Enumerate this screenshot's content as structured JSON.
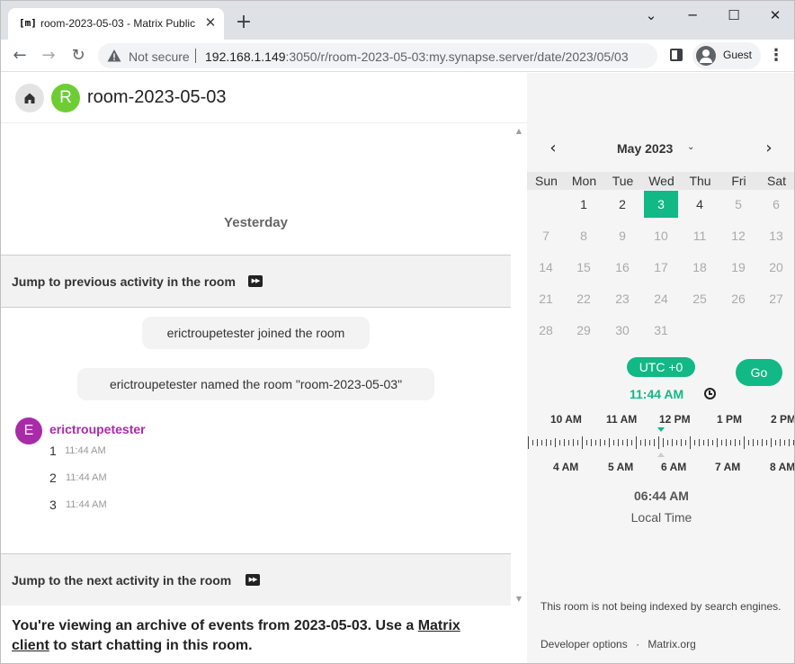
{
  "browser": {
    "tab_title": "room-2023-05-03 - Matrix Public",
    "tab_favicon_text": "[m]",
    "tab_close": "✕",
    "new_tab": "+",
    "window_controls": {
      "minimize": "⌄",
      "minimize2": "─",
      "maximize": "☐",
      "close": "✕"
    },
    "nav": {
      "back": "←",
      "forward": "→",
      "reload": "↻"
    },
    "security_label": "Not secure",
    "url_host": "192.168.1.149",
    "url_rest": ":3050/r/room-2023-05-03:my.synapse.server/date/2023/05/03",
    "profile_label": "Guest",
    "menu_glyph": "⋮"
  },
  "room": {
    "name": "room-2023-05-03",
    "avatar_letter": "R",
    "avatar_color": "#6dce33"
  },
  "timeline": {
    "day_divider": "Yesterday",
    "jump_previous": "Jump to previous activity in the room",
    "jump_next": "Jump to the next activity in the room",
    "jump_icon": "▶▶",
    "state_events": [
      "erictroupetester joined the room",
      "erictroupetester named the room \"room-2023-05-03\""
    ],
    "sender": {
      "name": "erictroupetester",
      "avatar_letter": "E",
      "color": "#a82ba8"
    },
    "messages": [
      {
        "body": "1",
        "time": "11:44 AM"
      },
      {
        "body": "2",
        "time": "11:44 AM"
      },
      {
        "body": "3",
        "time": "11:44 AM"
      }
    ],
    "scroll_up": "▲",
    "scroll_down": "▼"
  },
  "archive_notice": {
    "before_link": "You're viewing an archive of events from 2023-05-03. Use a ",
    "link_text_1": "Matrix",
    "link_text_2": "client",
    "after_link": " to start chatting in this room."
  },
  "calendar": {
    "prev": "‹",
    "next": "›",
    "month_label": "May 2023",
    "caret": "⌄",
    "weekdays": [
      "Sun",
      "Mon",
      "Tue",
      "Wed",
      "Thu",
      "Fri",
      "Sat"
    ],
    "weeks": [
      [
        "",
        "1",
        "2",
        "3",
        "4",
        "5",
        "6"
      ],
      [
        "7",
        "8",
        "9",
        "10",
        "11",
        "12",
        "13"
      ],
      [
        "14",
        "15",
        "16",
        "17",
        "18",
        "19",
        "20"
      ],
      [
        "21",
        "22",
        "23",
        "24",
        "25",
        "26",
        "27"
      ],
      [
        "28",
        "29",
        "30",
        "31",
        "",
        "",
        ""
      ]
    ],
    "active_days": [
      "1",
      "2",
      "3",
      "4"
    ],
    "selected_day": "3",
    "accent_color": "#12b886"
  },
  "time_picker": {
    "timezone_button": "UTC +0",
    "go_button": "Go",
    "selected_time": "11:44 AM",
    "top_labels": [
      "10 AM",
      "11 AM",
      "12 PM",
      "1 PM",
      "2 PM"
    ],
    "bottom_labels": [
      "4 AM",
      "5 AM",
      "6 AM",
      "7 AM",
      "8 AM"
    ],
    "local_time": "06:44 AM",
    "local_time_label": "Local Time"
  },
  "footer": {
    "index_note": "This room is not being indexed by search engines.",
    "developer_options": "Developer options",
    "separator": "·",
    "matrix_org": "Matrix.org"
  }
}
